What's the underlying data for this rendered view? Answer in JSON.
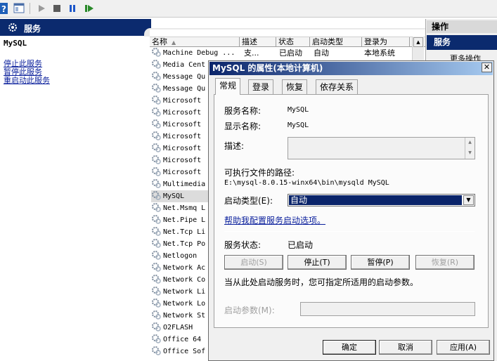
{
  "left_panel": {
    "header": "服务",
    "service_title": "MySQL",
    "actions": [
      "停止此服务",
      "暂停此服务",
      "重启动此服务"
    ]
  },
  "list": {
    "columns": [
      "名称",
      "描述",
      "状态",
      "启动类型",
      "登录为"
    ],
    "first_row": {
      "name": "Machine Debug ...",
      "desc": "支...",
      "status": "已启动",
      "startup": "自动",
      "logon": "本地系统"
    },
    "rows": [
      "Media Cent",
      "Message Qu",
      "Message Qu",
      "Microsoft",
      "Microsoft",
      "Microsoft",
      "Microsoft",
      "Microsoft",
      "Microsoft",
      "Microsoft",
      "Multimedia",
      "MySQL",
      "Net.Msmq L",
      "Net.Pipe L",
      "Net.Tcp Li",
      "Net.Tcp Po",
      "Netlogon",
      "Network Ac",
      "Network Co",
      "Network Li",
      "Network Lo",
      "Network St",
      "O2FLASH",
      "Office 64",
      "Office Sof"
    ],
    "selected_index": 11
  },
  "right_pane": {
    "header": "操作",
    "section": "服务",
    "more": "更多操作"
  },
  "dialog": {
    "title": "MySQL 的属性(本地计算机)",
    "close": "✕",
    "tabs": [
      "常规",
      "登录",
      "恢复",
      "依存关系"
    ],
    "active_tab": 0,
    "service_name_label": "服务名称:",
    "service_name": "MySQL",
    "display_name_label": "显示名称:",
    "display_name": "MySQL",
    "description_label": "描述:",
    "exe_path_label": "可执行文件的路径:",
    "exe_path": "E:\\mysql-8.0.15-winx64\\bin\\mysqld MySQL",
    "startup_type_label": "启动类型(E):",
    "startup_type_value": "自动",
    "help_link": "帮助我配置服务启动选项。",
    "status_label": "服务状态:",
    "status_value": "已启动",
    "btn_start": "启动(S)",
    "btn_stop": "停止(T)",
    "btn_pause": "暂停(P)",
    "btn_resume": "恢复(R)",
    "hint": "当从此处启动服务时，您可指定所适用的启动参数。",
    "params_label": "启动参数(M):",
    "ok": "确定",
    "cancel": "取消",
    "apply": "应用(A)"
  },
  "colors": {
    "header_blue": "#0b2a6e",
    "link_blue": "#0a1f9c",
    "combo_selected": "#0a246a"
  },
  "icons": [
    "help-icon",
    "console-tree-icon",
    "play-icon",
    "stop-icon",
    "pause-icon",
    "restart-icon",
    "gear-icon"
  ]
}
